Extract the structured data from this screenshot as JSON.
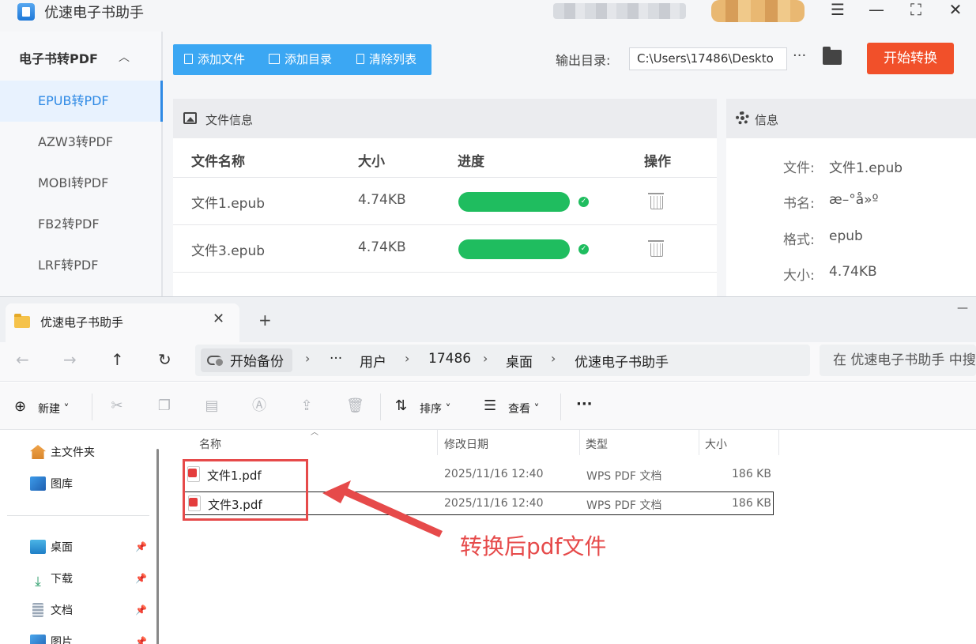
{
  "app": {
    "title": "优速电子书助手",
    "window_controls": [
      "☰",
      "—",
      "⛶",
      "✕"
    ],
    "sidebar": {
      "header": "电子书转PDF",
      "items": [
        {
          "label": "EPUB转PDF",
          "active": true
        },
        {
          "label": "AZW3转PDF",
          "active": false
        },
        {
          "label": "MOBI转PDF",
          "active": false
        },
        {
          "label": "FB2转PDF",
          "active": false
        },
        {
          "label": "LRF转PDF",
          "active": false
        }
      ]
    },
    "toolbar": {
      "add_file": "添加文件",
      "add_dir": "添加目录",
      "clear_list": "清除列表"
    },
    "output": {
      "label": "输出目录:",
      "path": "C:\\Users\\17486\\Deskto",
      "more": "···"
    },
    "start_button": "开始转换",
    "file_panel": {
      "title": "文件信息",
      "columns": [
        "文件名称",
        "大小",
        "进度",
        "操作"
      ],
      "rows": [
        {
          "name": "文件1.epub",
          "size": "4.74KB",
          "progress": 1.0
        },
        {
          "name": "文件3.epub",
          "size": "4.74KB",
          "progress": 1.0
        }
      ]
    },
    "info_panel": {
      "title": "信息",
      "fields": [
        {
          "label": "文件:",
          "value": "文件1.epub"
        },
        {
          "label": "书名:",
          "value": "æ–°å»º"
        },
        {
          "label": "格式:",
          "value": "epub"
        },
        {
          "label": "大小:",
          "value": "4.74KB"
        }
      ]
    }
  },
  "explorer": {
    "tab_title": "优速电子书助手",
    "breadcrumb": [
      "开始备份",
      "···",
      "用户",
      "17486",
      "桌面",
      "优速电子书助手"
    ],
    "search_placeholder": "在 优速电子书助手 中搜",
    "commands": {
      "new": "新建",
      "sort": "排序",
      "view": "查看",
      "more": "···"
    },
    "nav": [
      {
        "label": "主文件夹",
        "icon": "home-icon",
        "pinned": false
      },
      {
        "label": "图库",
        "icon": "gallery-icon",
        "pinned": false
      },
      {
        "label": "桌面",
        "icon": "desktop-icon",
        "pinned": true
      },
      {
        "label": "下载",
        "icon": "download-icon",
        "pinned": true
      },
      {
        "label": "文档",
        "icon": "document-icon",
        "pinned": true
      },
      {
        "label": "图片",
        "icon": "pictures-icon",
        "pinned": true
      }
    ],
    "columns": [
      "名称",
      "修改日期",
      "类型",
      "大小"
    ],
    "files": [
      {
        "name": "文件1.pdf",
        "modified": "2025/11/16 12:40",
        "type": "WPS PDF 文档",
        "size": "186 KB"
      },
      {
        "name": "文件3.pdf",
        "modified": "2025/11/16 12:40",
        "type": "WPS PDF 文档",
        "size": "186 KB"
      }
    ]
  },
  "annotation": {
    "text": "转换后pdf文件",
    "color": "#e64a4a"
  },
  "colors": {
    "accent_blue": "#3ba7f3",
    "start_orange": "#f1502a",
    "progress_green": "#1fbd5f",
    "active_text": "#2f8ae5"
  }
}
